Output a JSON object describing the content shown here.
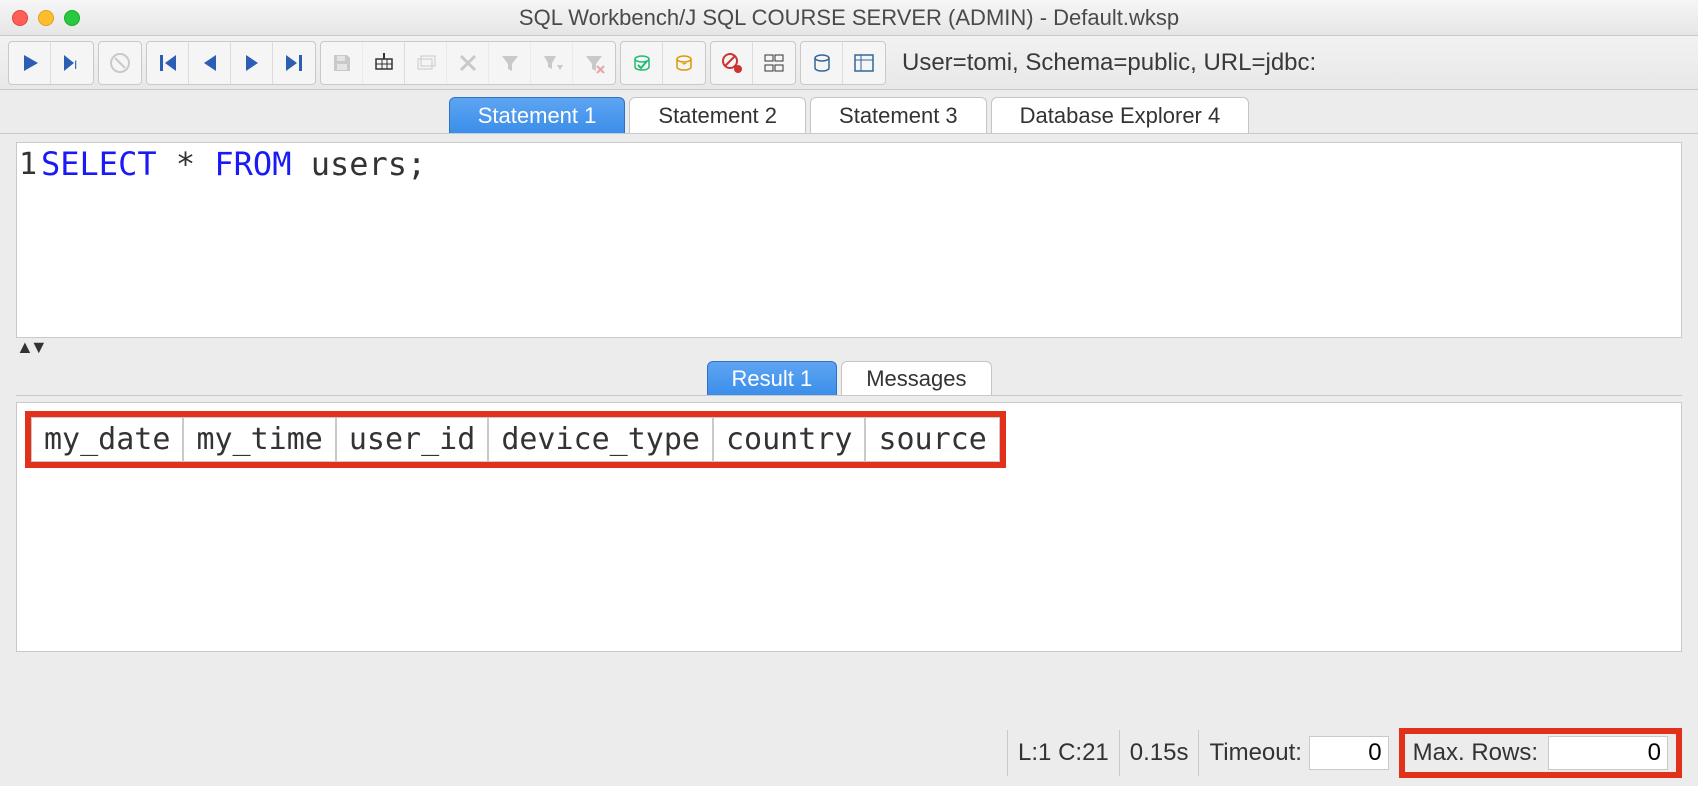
{
  "window": {
    "title": "SQL Workbench/J SQL COURSE SERVER (ADMIN) - Default.wksp"
  },
  "connection_info": "User=tomi, Schema=public, URL=jdbc:",
  "tabs": [
    {
      "label": "Statement 1",
      "active": true
    },
    {
      "label": "Statement 2",
      "active": false
    },
    {
      "label": "Statement 3",
      "active": false
    },
    {
      "label": "Database Explorer 4",
      "active": false
    }
  ],
  "editor": {
    "line_number": "1",
    "sql_keyword1": "SELECT",
    "sql_star": " * ",
    "sql_keyword2": "FROM",
    "sql_rest": " users;"
  },
  "result_tabs": [
    {
      "label": "Result 1",
      "active": true
    },
    {
      "label": "Messages",
      "active": false
    }
  ],
  "result_columns": [
    "my_date",
    "my_time",
    "user_id",
    "device_type",
    "country",
    "source"
  ],
  "status": {
    "cursor": "L:1 C:21",
    "elapsed": "0.15s",
    "timeout_label": "Timeout:",
    "timeout_value": "0",
    "maxrows_label": "Max. Rows:",
    "maxrows_value": "0"
  }
}
